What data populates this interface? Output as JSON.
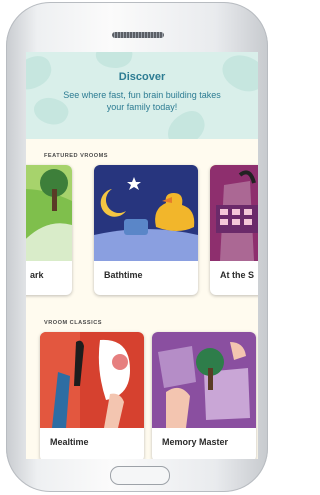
{
  "discover": {
    "title": "Discover",
    "subtitle": "See where fast, fun brain building takes your family today!"
  },
  "featured": {
    "heading": "FEATURED VROOMS",
    "cards": [
      "ark",
      "Bathtime",
      "At the S"
    ]
  },
  "classics": {
    "heading": "VROOM CLASSICS",
    "cards": [
      "Mealtime",
      "Memory Master"
    ]
  },
  "colors": {
    "accent": "#2d7c93",
    "hero_bg": "#d9efea",
    "screen_bg": "#fffbef"
  }
}
